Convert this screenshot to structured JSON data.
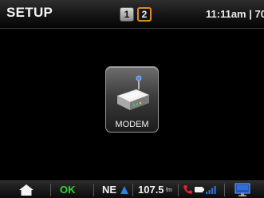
{
  "header": {
    "title": "SETUP",
    "pages": [
      "1",
      "2"
    ],
    "active_page": "2",
    "clock": "11:11am | 70"
  },
  "main": {
    "tile_label": "MODEM",
    "tile_icon": "modem-icon"
  },
  "status_bar": {
    "home_icon": "home-icon",
    "status": "OK",
    "compass_direction": "NE",
    "compass_icon": "compass-arrow-icon",
    "radio_frequency": "107.5",
    "radio_unit": "fm",
    "phone_icon": "phone-icon",
    "battery_icon": "battery-icon",
    "signal_icon": "signal-icon",
    "screen_icon": "screen-icon"
  },
  "colors": {
    "accent_orange": "#e08a1e",
    "ok_green": "#32d232",
    "phone_red": "#e0232a",
    "signal_blue": "#2f6fd6"
  }
}
